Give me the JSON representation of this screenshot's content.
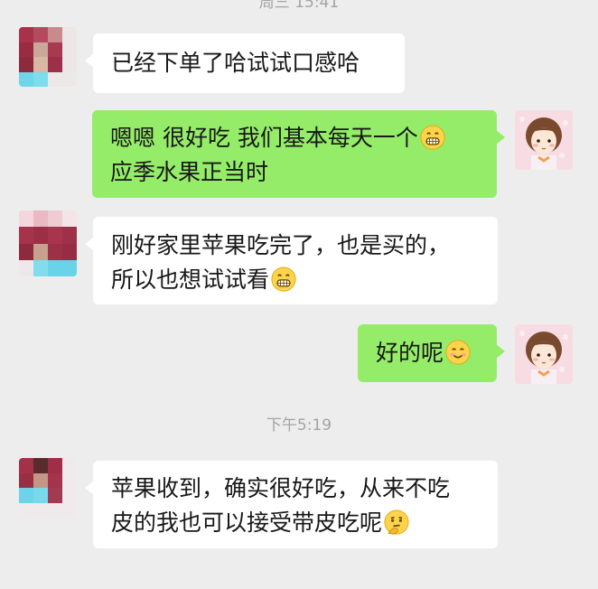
{
  "timestamps": {
    "top": "周三 15:41",
    "middle": "下午5:19"
  },
  "messages": [
    {
      "side": "left",
      "lines": [
        "已经下单了哈试试口感哈"
      ]
    },
    {
      "side": "right",
      "lines": [
        "嗯嗯 很好吃 我们基本每天一个",
        "应季水果正当时"
      ],
      "emoji": "grinning-face-emoji"
    },
    {
      "side": "left",
      "lines": [
        "刚好家里苹果吃完了，也是买的，",
        "所以也想试试看"
      ],
      "emoji": "grinning-face-emoji"
    },
    {
      "side": "right",
      "lines": [
        "好的呢"
      ],
      "emoji": "smiling-face-emoji"
    },
    {
      "side": "left",
      "lines": [
        "苹果收到，确实很好吃，从来不吃",
        "皮的我也可以接受带皮吃呢"
      ],
      "emoji": "thinking-face-emoji"
    }
  ],
  "colors": {
    "background": "#ededed",
    "incoming_bubble": "#ffffff",
    "outgoing_bubble": "#95ec69",
    "timestamp_text": "#a3a3a3"
  }
}
